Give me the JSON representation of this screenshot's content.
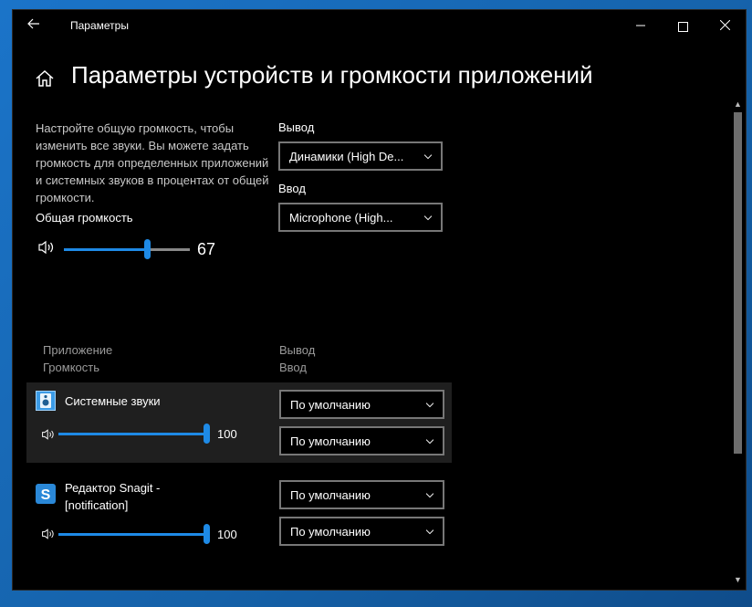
{
  "window": {
    "title": "Параметры"
  },
  "page": {
    "title": "Параметры устройств и громкости приложений"
  },
  "master": {
    "description": "Настройте общую громкость, чтобы изменить все звуки. Вы можете задать громкость для определенных приложений и системных звуков в процентах от общей громкости.",
    "label": "Общая громкость",
    "value": "67",
    "level": 67
  },
  "output": {
    "label": "Вывод",
    "selected": "Динамики (High De..."
  },
  "input": {
    "label": "Ввод",
    "selected": "Microphone (High..."
  },
  "columns": {
    "app": "Приложение",
    "volume": "Громкость",
    "output": "Вывод",
    "input": "Ввод"
  },
  "apps": [
    {
      "name": "Системные звуки",
      "volume": "100",
      "level": 100,
      "output": "По умолчанию",
      "input": "По умолчанию",
      "icon": "system-sounds-icon"
    },
    {
      "name": "Редактор Snagit - [notification]",
      "volume": "100",
      "level": 100,
      "output": "По умолчанию",
      "input": "По умолчанию",
      "icon": "snagit-icon"
    }
  ],
  "colors": {
    "accent": "#1e8ae6",
    "background": "#000000",
    "selected_row": "#1f1f1f"
  }
}
